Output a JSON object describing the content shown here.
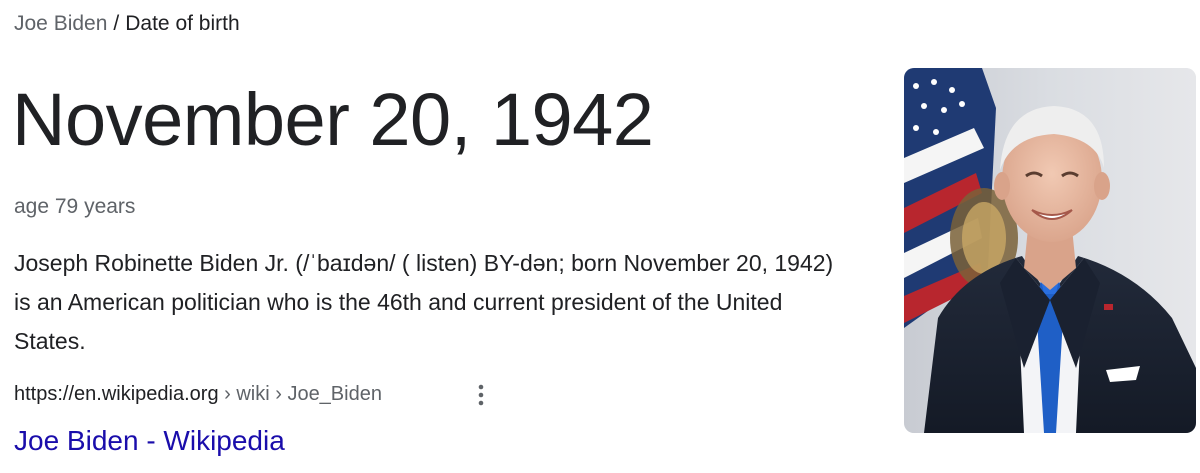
{
  "breadcrumb": {
    "parent": "Joe Biden",
    "separator": "/",
    "current": "Date of birth"
  },
  "answer": {
    "date": "November 20, 1942",
    "age": "age 79 years"
  },
  "snippet": {
    "text_before_listen": "Joseph Robinette Biden Jr. (/ˈbaɪdən/ (",
    "listen_label": " listen)",
    "text_after_listen": " BY-dən; born November 20, 1942) is an American politician who is the 46th and current president of the United States."
  },
  "source": {
    "domain": "https://en.wikipedia.org",
    "path": " › wiki › Joe_Biden",
    "title": "Joe Biden - Wikipedia"
  },
  "icons": {
    "more": "more-vert-icon",
    "listen": "speaker-icon"
  },
  "colors": {
    "link": "#1a0dab",
    "secondary_text": "#5f6368",
    "primary_text": "#202124"
  }
}
